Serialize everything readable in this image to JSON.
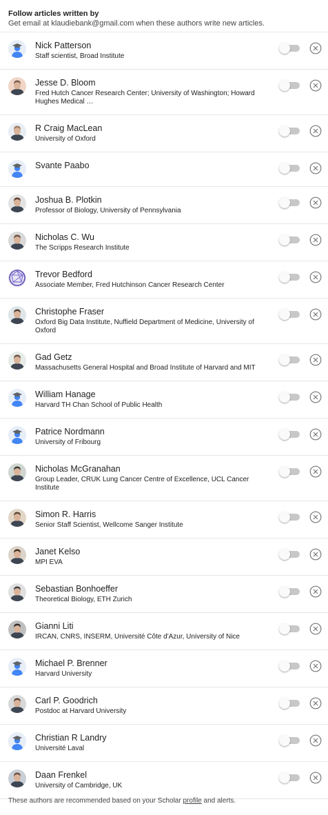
{
  "header": {
    "title": "Follow articles written by",
    "subtitle": "Get email at klaudiebank@gmail.com when these authors write new articles."
  },
  "authors": [
    {
      "name": "Nick Patterson",
      "affiliation": "Staff scientist, Broad Institute",
      "avatar": "default-scholar-avatar",
      "following": false
    },
    {
      "name": "Jesse D. Bloom",
      "affiliation": "Fred Hutch Cancer Research Center; University of Washington; Howard Hughes Medical …",
      "avatar": "photo",
      "following": false
    },
    {
      "name": "R Craig MacLean",
      "affiliation": "University of Oxford",
      "avatar": "photo",
      "following": false
    },
    {
      "name": "Svante Paabo",
      "affiliation": "",
      "avatar": "default-scholar-avatar",
      "following": false
    },
    {
      "name": "Joshua B. Plotkin",
      "affiliation": "Professor of Biology, University of Pennsylvania",
      "avatar": "photo",
      "following": false
    },
    {
      "name": "Nicholas C. Wu",
      "affiliation": "The Scripps Research Institute",
      "avatar": "photo",
      "following": false
    },
    {
      "name": "Trevor Bedford",
      "affiliation": "Associate Member, Fred Hutchinson Cancer Research Center",
      "avatar": "graphic",
      "following": false
    },
    {
      "name": "Christophe Fraser",
      "affiliation": "Oxford Big Data Institute, Nuffield Department of Medicine, University of Oxford",
      "avatar": "photo",
      "following": false
    },
    {
      "name": "Gad Getz",
      "affiliation": "Massachusetts General Hospital and Broad Institute of Harvard and MIT",
      "avatar": "photo",
      "following": false
    },
    {
      "name": "William Hanage",
      "affiliation": "Harvard TH Chan School of Public Health",
      "avatar": "default-scholar-avatar",
      "following": false
    },
    {
      "name": "Patrice Nordmann",
      "affiliation": "University of Fribourg",
      "avatar": "default-scholar-avatar",
      "following": false
    },
    {
      "name": "Nicholas McGranahan",
      "affiliation": "Group Leader, CRUK Lung Cancer Centre of Excellence, UCL Cancer Institute",
      "avatar": "photo",
      "following": false
    },
    {
      "name": "Simon R. Harris",
      "affiliation": "Senior Staff Scientist, Wellcome Sanger Institute",
      "avatar": "photo",
      "following": false
    },
    {
      "name": "Janet Kelso",
      "affiliation": "MPI EVA",
      "avatar": "photo",
      "following": false
    },
    {
      "name": "Sebastian Bonhoeffer",
      "affiliation": "Theoretical Biology, ETH Zurich",
      "avatar": "photo",
      "following": false
    },
    {
      "name": "Gianni Liti",
      "affiliation": "IRCAN, CNRS, INSERM, Université Côte d'Azur, University of Nice",
      "avatar": "photo",
      "following": false
    },
    {
      "name": "Michael P. Brenner",
      "affiliation": "Harvard University",
      "avatar": "default-scholar-avatar",
      "following": false
    },
    {
      "name": "Carl P. Goodrich",
      "affiliation": "Postdoc at Harvard University",
      "avatar": "photo",
      "following": false
    },
    {
      "name": "Christian R Landry",
      "affiliation": "Université Laval",
      "avatar": "default-scholar-avatar",
      "following": false
    },
    {
      "name": "Daan Frenkel",
      "affiliation": "University of Cambridge, UK",
      "avatar": "photo",
      "following": false
    }
  ],
  "footer": {
    "text_before": "These authors are recommended based on your Scholar ",
    "link": "profile",
    "text_after": " and alerts."
  },
  "icons": {
    "toggle": "toggle-switch-off",
    "remove": "close-circle-icon"
  },
  "colors": {
    "toggle_track": "#c8c8c8",
    "toggle_knob": "#fafafa",
    "icon_gray": "#777777",
    "avatar_blue": "#4285f4"
  }
}
